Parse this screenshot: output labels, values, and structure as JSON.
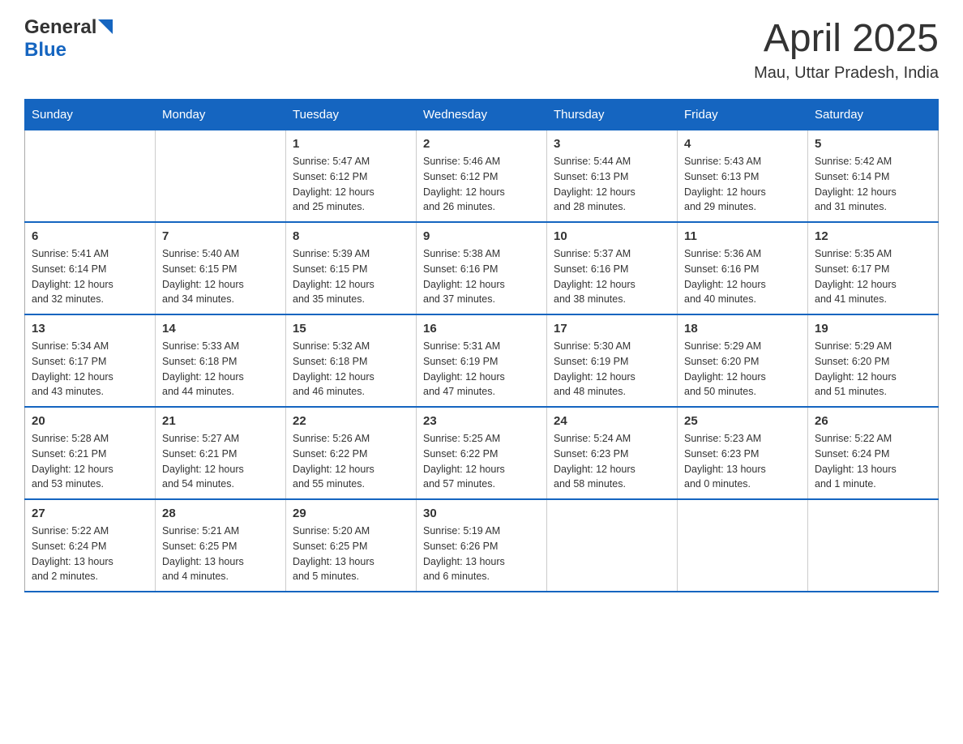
{
  "header": {
    "logo_general": "General",
    "logo_blue": "Blue",
    "month_year": "April 2025",
    "location": "Mau, Uttar Pradesh, India"
  },
  "days_of_week": [
    "Sunday",
    "Monday",
    "Tuesday",
    "Wednesday",
    "Thursday",
    "Friday",
    "Saturday"
  ],
  "weeks": [
    [
      {
        "day": "",
        "info": ""
      },
      {
        "day": "",
        "info": ""
      },
      {
        "day": "1",
        "info": "Sunrise: 5:47 AM\nSunset: 6:12 PM\nDaylight: 12 hours\nand 25 minutes."
      },
      {
        "day": "2",
        "info": "Sunrise: 5:46 AM\nSunset: 6:12 PM\nDaylight: 12 hours\nand 26 minutes."
      },
      {
        "day": "3",
        "info": "Sunrise: 5:44 AM\nSunset: 6:13 PM\nDaylight: 12 hours\nand 28 minutes."
      },
      {
        "day": "4",
        "info": "Sunrise: 5:43 AM\nSunset: 6:13 PM\nDaylight: 12 hours\nand 29 minutes."
      },
      {
        "day": "5",
        "info": "Sunrise: 5:42 AM\nSunset: 6:14 PM\nDaylight: 12 hours\nand 31 minutes."
      }
    ],
    [
      {
        "day": "6",
        "info": "Sunrise: 5:41 AM\nSunset: 6:14 PM\nDaylight: 12 hours\nand 32 minutes."
      },
      {
        "day": "7",
        "info": "Sunrise: 5:40 AM\nSunset: 6:15 PM\nDaylight: 12 hours\nand 34 minutes."
      },
      {
        "day": "8",
        "info": "Sunrise: 5:39 AM\nSunset: 6:15 PM\nDaylight: 12 hours\nand 35 minutes."
      },
      {
        "day": "9",
        "info": "Sunrise: 5:38 AM\nSunset: 6:16 PM\nDaylight: 12 hours\nand 37 minutes."
      },
      {
        "day": "10",
        "info": "Sunrise: 5:37 AM\nSunset: 6:16 PM\nDaylight: 12 hours\nand 38 minutes."
      },
      {
        "day": "11",
        "info": "Sunrise: 5:36 AM\nSunset: 6:16 PM\nDaylight: 12 hours\nand 40 minutes."
      },
      {
        "day": "12",
        "info": "Sunrise: 5:35 AM\nSunset: 6:17 PM\nDaylight: 12 hours\nand 41 minutes."
      }
    ],
    [
      {
        "day": "13",
        "info": "Sunrise: 5:34 AM\nSunset: 6:17 PM\nDaylight: 12 hours\nand 43 minutes."
      },
      {
        "day": "14",
        "info": "Sunrise: 5:33 AM\nSunset: 6:18 PM\nDaylight: 12 hours\nand 44 minutes."
      },
      {
        "day": "15",
        "info": "Sunrise: 5:32 AM\nSunset: 6:18 PM\nDaylight: 12 hours\nand 46 minutes."
      },
      {
        "day": "16",
        "info": "Sunrise: 5:31 AM\nSunset: 6:19 PM\nDaylight: 12 hours\nand 47 minutes."
      },
      {
        "day": "17",
        "info": "Sunrise: 5:30 AM\nSunset: 6:19 PM\nDaylight: 12 hours\nand 48 minutes."
      },
      {
        "day": "18",
        "info": "Sunrise: 5:29 AM\nSunset: 6:20 PM\nDaylight: 12 hours\nand 50 minutes."
      },
      {
        "day": "19",
        "info": "Sunrise: 5:29 AM\nSunset: 6:20 PM\nDaylight: 12 hours\nand 51 minutes."
      }
    ],
    [
      {
        "day": "20",
        "info": "Sunrise: 5:28 AM\nSunset: 6:21 PM\nDaylight: 12 hours\nand 53 minutes."
      },
      {
        "day": "21",
        "info": "Sunrise: 5:27 AM\nSunset: 6:21 PM\nDaylight: 12 hours\nand 54 minutes."
      },
      {
        "day": "22",
        "info": "Sunrise: 5:26 AM\nSunset: 6:22 PM\nDaylight: 12 hours\nand 55 minutes."
      },
      {
        "day": "23",
        "info": "Sunrise: 5:25 AM\nSunset: 6:22 PM\nDaylight: 12 hours\nand 57 minutes."
      },
      {
        "day": "24",
        "info": "Sunrise: 5:24 AM\nSunset: 6:23 PM\nDaylight: 12 hours\nand 58 minutes."
      },
      {
        "day": "25",
        "info": "Sunrise: 5:23 AM\nSunset: 6:23 PM\nDaylight: 13 hours\nand 0 minutes."
      },
      {
        "day": "26",
        "info": "Sunrise: 5:22 AM\nSunset: 6:24 PM\nDaylight: 13 hours\nand 1 minute."
      }
    ],
    [
      {
        "day": "27",
        "info": "Sunrise: 5:22 AM\nSunset: 6:24 PM\nDaylight: 13 hours\nand 2 minutes."
      },
      {
        "day": "28",
        "info": "Sunrise: 5:21 AM\nSunset: 6:25 PM\nDaylight: 13 hours\nand 4 minutes."
      },
      {
        "day": "29",
        "info": "Sunrise: 5:20 AM\nSunset: 6:25 PM\nDaylight: 13 hours\nand 5 minutes."
      },
      {
        "day": "30",
        "info": "Sunrise: 5:19 AM\nSunset: 6:26 PM\nDaylight: 13 hours\nand 6 minutes."
      },
      {
        "day": "",
        "info": ""
      },
      {
        "day": "",
        "info": ""
      },
      {
        "day": "",
        "info": ""
      }
    ]
  ]
}
